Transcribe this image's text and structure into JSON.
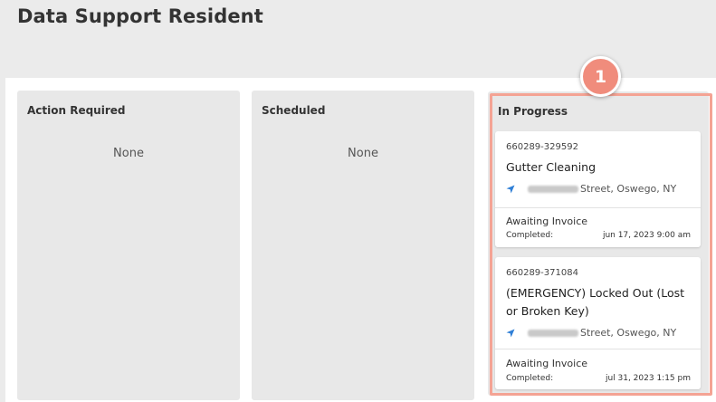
{
  "page": {
    "title": "Data Support Resident"
  },
  "columns": [
    {
      "title": "Action Required",
      "empty_text": "None"
    },
    {
      "title": "Scheduled",
      "empty_text": "None"
    },
    {
      "title": "In Progress"
    }
  ],
  "step_badge": "1",
  "cards": [
    {
      "id": "660289-329592",
      "title": "Gutter Cleaning",
      "address": "Street, Oswego, NY",
      "status": "Awaiting Invoice",
      "completed_label": "Completed:",
      "completed_date": "jun 17, 2023 9:00 am"
    },
    {
      "id": "660289-371084",
      "title": "(EMERGENCY) Locked Out (Lost or Broken Key)",
      "address": "Street, Oswego, NY",
      "status": "Awaiting Invoice",
      "completed_label": "Completed:",
      "completed_date": "jul 31, 2023 1:15 pm"
    }
  ],
  "colors": {
    "accent": "#f08c7c",
    "highlight": "#f4a394",
    "nav_icon": "#2f7fd6"
  },
  "icons": {
    "address": "navigation-arrow-icon"
  }
}
